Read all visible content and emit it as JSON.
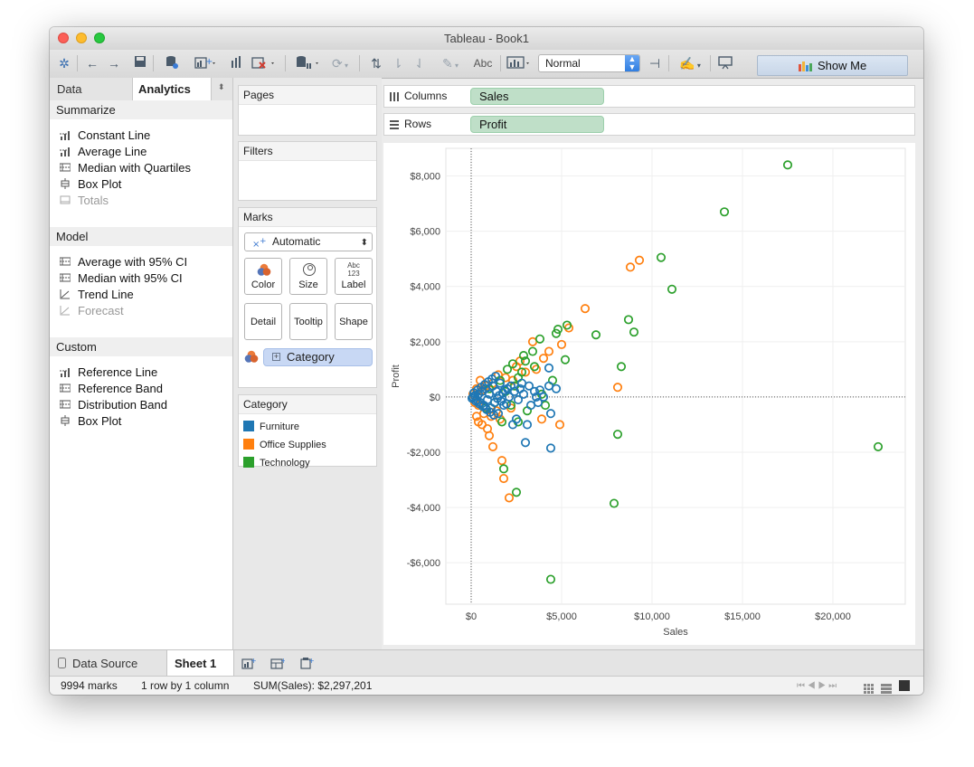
{
  "window": {
    "title": "Tableau - Book1"
  },
  "toolbar": {
    "abc_label": "Abc",
    "view_fit": "Normal",
    "show_me_label": "Show Me"
  },
  "left_pane": {
    "tabs": [
      {
        "label": "Data"
      },
      {
        "label": "Analytics"
      }
    ],
    "sections": [
      {
        "title": "Summarize",
        "items": [
          {
            "label": "Constant Line",
            "enabled": true
          },
          {
            "label": "Average Line",
            "enabled": true
          },
          {
            "label": "Median with Quartiles",
            "enabled": true
          },
          {
            "label": "Box Plot",
            "enabled": true
          },
          {
            "label": "Totals",
            "enabled": false
          }
        ]
      },
      {
        "title": "Model",
        "items": [
          {
            "label": "Average with 95% CI",
            "enabled": true
          },
          {
            "label": "Median with 95% CI",
            "enabled": true
          },
          {
            "label": "Trend Line",
            "enabled": true
          },
          {
            "label": "Forecast",
            "enabled": false
          }
        ]
      },
      {
        "title": "Custom",
        "items": [
          {
            "label": "Reference Line",
            "enabled": true
          },
          {
            "label": "Reference Band",
            "enabled": true
          },
          {
            "label": "Distribution Band",
            "enabled": true
          },
          {
            "label": "Box Plot",
            "enabled": true
          }
        ]
      }
    ]
  },
  "cards": {
    "pages_title": "Pages",
    "filters_title": "Filters",
    "marks_title": "Marks",
    "mark_type": "Automatic",
    "mark_buttons": [
      "Color",
      "Size",
      "Label",
      "Detail",
      "Tooltip",
      "Shape"
    ],
    "label_icon_text": "Abc\n123",
    "color_field": "Category",
    "legend_title": "Category",
    "legend_items": [
      {
        "label": "Furniture",
        "color": "#1f77b4"
      },
      {
        "label": "Office Supplies",
        "color": "#ff7f0e"
      },
      {
        "label": "Technology",
        "color": "#2ca02c"
      }
    ]
  },
  "shelves": {
    "columns_label": "Columns",
    "columns_field": "Sales",
    "rows_label": "Rows",
    "rows_field": "Profit"
  },
  "chart_data": {
    "type": "scatter",
    "xlabel": "Sales",
    "ylabel": "Profit",
    "xlim": [
      -1400,
      24000
    ],
    "ylim": [
      -7500,
      9000
    ],
    "x_ticks": [
      0,
      5000,
      10000,
      15000,
      20000
    ],
    "x_tick_labels": [
      "$0",
      "$5,000",
      "$10,000",
      "$15,000",
      "$20,000"
    ],
    "y_ticks": [
      -6000,
      -4000,
      -2000,
      0,
      2000,
      4000,
      6000,
      8000
    ],
    "y_tick_labels": [
      "-$6,000",
      "-$4,000",
      "-$2,000",
      "$0",
      "$2,000",
      "$4,000",
      "$6,000",
      "$8,000"
    ],
    "zero_lines": true,
    "marker": "open-circle",
    "series": [
      {
        "name": "Furniture",
        "color": "#1f77b4",
        "points": [
          [
            4400,
            -600
          ],
          [
            4400,
            -1850
          ],
          [
            3000,
            -1650
          ],
          [
            3100,
            -1000
          ],
          [
            4300,
            1050
          ],
          [
            4300,
            400
          ],
          [
            4700,
            300
          ],
          [
            3600,
            0
          ],
          [
            3800,
            250
          ],
          [
            3300,
            -300
          ],
          [
            2800,
            500
          ],
          [
            2500,
            -800
          ],
          [
            2300,
            -1000
          ],
          [
            2000,
            300
          ],
          [
            1800,
            -300
          ],
          [
            1600,
            500
          ],
          [
            1500,
            -600
          ],
          [
            1400,
            200
          ],
          [
            1300,
            -200
          ],
          [
            1200,
            400
          ],
          [
            1100,
            -400
          ],
          [
            1000,
            100
          ],
          [
            900,
            -100
          ],
          [
            800,
            300
          ],
          [
            700,
            -300
          ],
          [
            600,
            200
          ],
          [
            500,
            -200
          ],
          [
            400,
            100
          ],
          [
            300,
            -100
          ],
          [
            200,
            50
          ],
          [
            100,
            0
          ],
          [
            50,
            -50
          ],
          [
            150,
            150
          ],
          [
            250,
            -150
          ],
          [
            350,
            250
          ],
          [
            450,
            -250
          ],
          [
            550,
            350
          ],
          [
            650,
            -350
          ],
          [
            750,
            450
          ],
          [
            850,
            -450
          ],
          [
            950,
            550
          ],
          [
            1050,
            -550
          ],
          [
            1150,
            650
          ],
          [
            1250,
            -650
          ],
          [
            1350,
            750
          ],
          [
            1450,
            -50
          ],
          [
            1550,
            50
          ],
          [
            1650,
            -150
          ],
          [
            1750,
            150
          ],
          [
            1850,
            250
          ],
          [
            1950,
            -250
          ],
          [
            2100,
            0
          ],
          [
            2200,
            400
          ],
          [
            2400,
            200
          ],
          [
            2600,
            -100
          ],
          [
            2700,
            300
          ],
          [
            2900,
            100
          ],
          [
            3200,
            400
          ],
          [
            3500,
            200
          ],
          [
            3700,
            -200
          ],
          [
            4000,
            0
          ]
        ]
      },
      {
        "name": "Office Supplies",
        "color": "#ff7f0e",
        "points": [
          [
            8800,
            4700
          ],
          [
            9300,
            4950
          ],
          [
            6300,
            3200
          ],
          [
            5400,
            2500
          ],
          [
            4300,
            1650
          ],
          [
            4000,
            1400
          ],
          [
            3400,
            2000
          ],
          [
            5000,
            1900
          ],
          [
            2700,
            1300
          ],
          [
            2500,
            1100
          ],
          [
            8100,
            350
          ],
          [
            4900,
            -1000
          ],
          [
            3900,
            -800
          ],
          [
            2100,
            -3650
          ],
          [
            1800,
            -2950
          ],
          [
            1700,
            -2300
          ],
          [
            1200,
            -1800
          ],
          [
            1000,
            -1400
          ],
          [
            900,
            -1150
          ],
          [
            600,
            -1000
          ],
          [
            400,
            -900
          ],
          [
            300,
            -700
          ],
          [
            2200,
            -400
          ],
          [
            1500,
            800
          ],
          [
            1200,
            500
          ],
          [
            800,
            400
          ],
          [
            600,
            250
          ],
          [
            400,
            -300
          ],
          [
            200,
            -200
          ],
          [
            100,
            100
          ],
          [
            1600,
            -800
          ],
          [
            1900,
            700
          ],
          [
            1400,
            -500
          ],
          [
            1100,
            -700
          ],
          [
            700,
            -600
          ],
          [
            500,
            600
          ],
          [
            300,
            300
          ],
          [
            2300,
            600
          ],
          [
            3000,
            900
          ],
          [
            3600,
            1000
          ]
        ]
      },
      {
        "name": "Technology",
        "color": "#2ca02c",
        "points": [
          [
            17500,
            8400
          ],
          [
            14000,
            6700
          ],
          [
            10500,
            5050
          ],
          [
            11100,
            3900
          ],
          [
            8700,
            2800
          ],
          [
            6900,
            2250
          ],
          [
            9000,
            2350
          ],
          [
            8300,
            1100
          ],
          [
            8100,
            -1350
          ],
          [
            7900,
            -3850
          ],
          [
            22500,
            -1800
          ],
          [
            4400,
            -6600
          ],
          [
            2500,
            -3450
          ],
          [
            1800,
            -2600
          ],
          [
            5200,
            1350
          ],
          [
            4700,
            2300
          ],
          [
            4800,
            2450
          ],
          [
            5300,
            2600
          ],
          [
            3800,
            2100
          ],
          [
            3400,
            1650
          ],
          [
            3000,
            1300
          ],
          [
            2800,
            900
          ],
          [
            2600,
            700
          ],
          [
            2400,
            400
          ],
          [
            2200,
            -300
          ],
          [
            2600,
            -900
          ],
          [
            3100,
            -500
          ],
          [
            3900,
            100
          ],
          [
            4100,
            -300
          ],
          [
            1900,
            200
          ],
          [
            1600,
            600
          ],
          [
            1300,
            -200
          ],
          [
            1000,
            300
          ],
          [
            800,
            -400
          ],
          [
            2000,
            1000
          ],
          [
            2300,
            1200
          ],
          [
            2900,
            1500
          ],
          [
            3500,
            1100
          ],
          [
            4500,
            600
          ],
          [
            1700,
            -900
          ]
        ]
      }
    ]
  },
  "tabs_bottom": {
    "data_source": "Data Source",
    "sheet": "Sheet 1"
  },
  "status": {
    "marks": "9994 marks",
    "dims": "1 row by 1 column",
    "sum": "SUM(Sales): $2,297,201"
  }
}
